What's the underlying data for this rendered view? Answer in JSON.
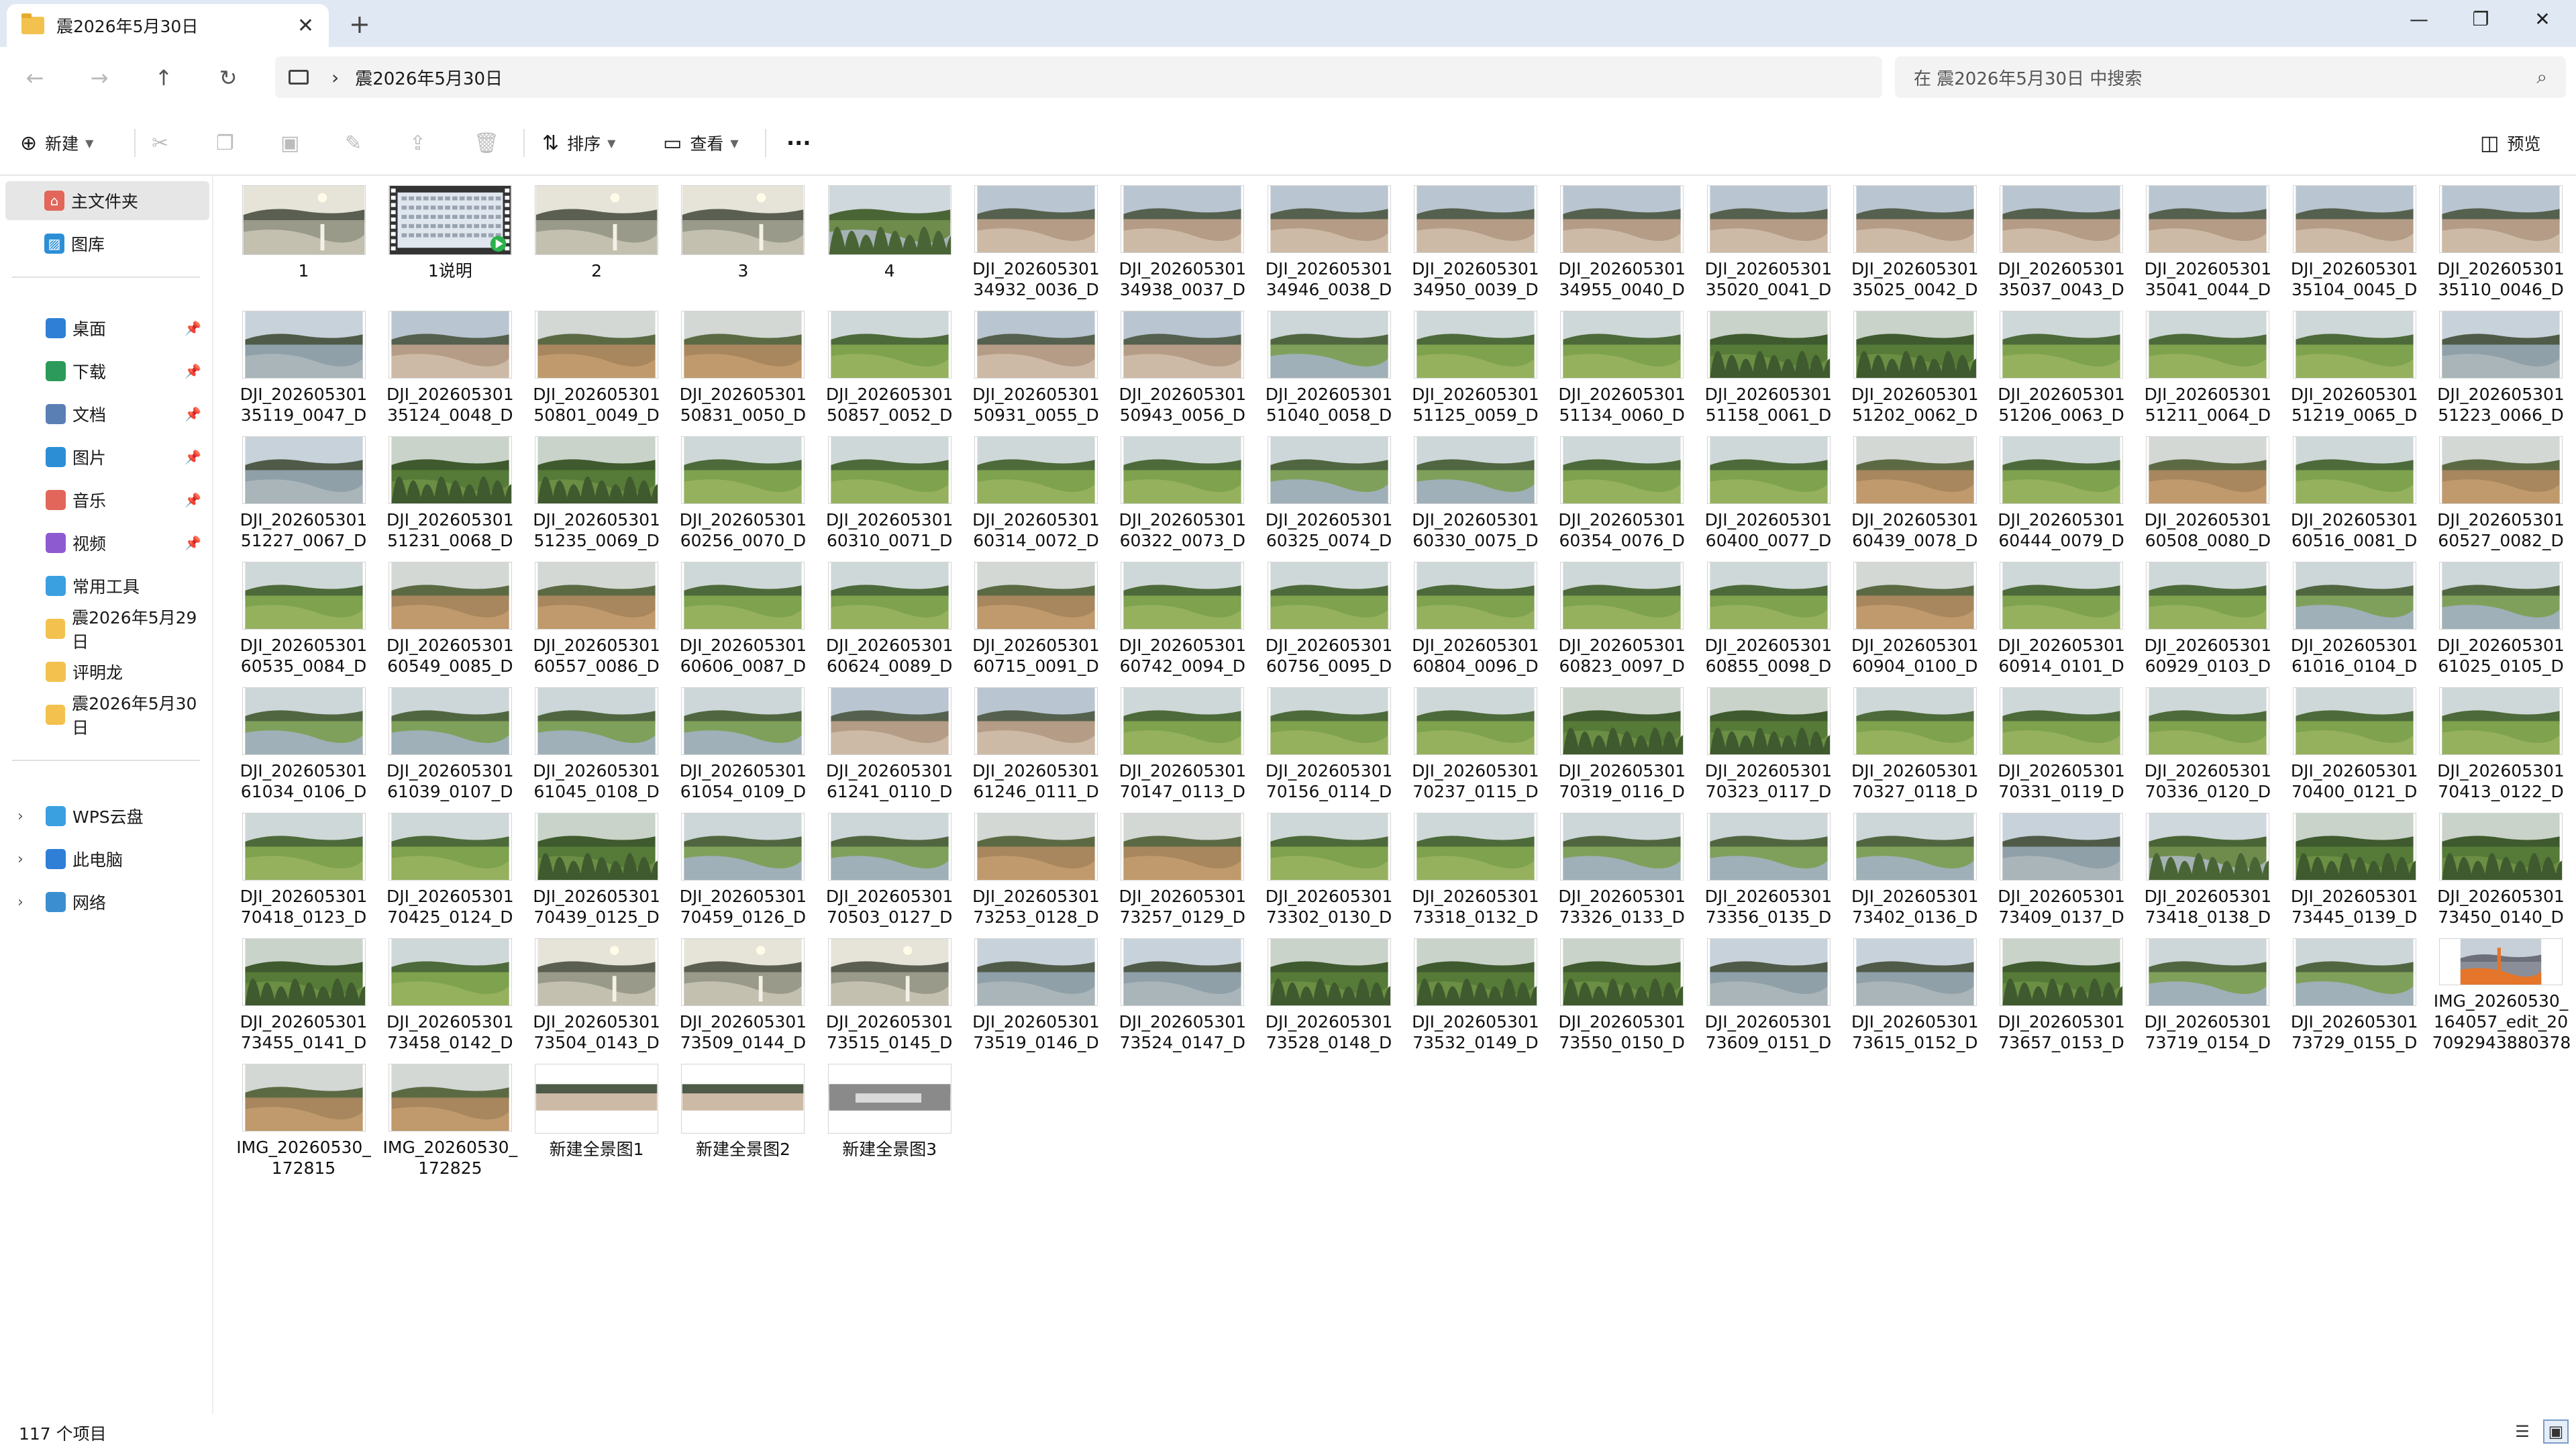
{
  "window": {
    "tab_title": "震2026年5月30日",
    "close_tab": "✕",
    "new_tab": "+",
    "minimize": "—",
    "maximize": "❐",
    "close": "✕"
  },
  "address": {
    "crumb": "震2026年5月30日",
    "search_placeholder": "在 震2026年5月30日 中搜索"
  },
  "toolbar": {
    "new_label": "新建",
    "sort_label": "排序",
    "view_label": "查看",
    "more_label": "···",
    "preview_label": "预览"
  },
  "sidebar": {
    "home": "主文件夹",
    "gallery": "图库",
    "quick": [
      {
        "label": "桌面",
        "icon": "desktop-icon",
        "color": "#2f7fd6"
      },
      {
        "label": "下载",
        "icon": "download-icon",
        "color": "#2c9a5a"
      },
      {
        "label": "文档",
        "icon": "documents-icon",
        "color": "#5a7fb5"
      },
      {
        "label": "图片",
        "icon": "pictures-icon",
        "color": "#2c8fd6"
      },
      {
        "label": "音乐",
        "icon": "music-icon",
        "color": "#e2665a"
      },
      {
        "label": "视频",
        "icon": "videos-icon",
        "color": "#8e5ad0"
      }
    ],
    "folders": [
      "常用工具",
      "震2026年5月29日",
      "评明龙",
      "震2026年5月30日"
    ],
    "locations": [
      "WPS云盘",
      "此电脑",
      "网络"
    ]
  },
  "status": {
    "item_count": "117 个项目"
  },
  "files": [
    {
      "l1": "1",
      "l2": "",
      "t": "lake-sunset"
    },
    {
      "l1": "1说明",
      "l2": "",
      "t": "video"
    },
    {
      "l1": "2",
      "l2": "",
      "t": "lake-sunset"
    },
    {
      "l1": "3",
      "l2": "",
      "t": "lake-sunset"
    },
    {
      "l1": "4",
      "l2": "",
      "t": "shore-trees"
    },
    {
      "l1": "DJI_202605301",
      "l2": "34932_0036_D",
      "t": "mudflat"
    },
    {
      "l1": "DJI_202605301",
      "l2": "34938_0037_D",
      "t": "mudflat"
    },
    {
      "l1": "DJI_202605301",
      "l2": "34946_0038_D",
      "t": "mudflat"
    },
    {
      "l1": "DJI_202605301",
      "l2": "34950_0039_D",
      "t": "mudflat"
    },
    {
      "l1": "DJI_202605301",
      "l2": "34955_0040_D",
      "t": "mudflat"
    },
    {
      "l1": "DJI_202605301",
      "l2": "35020_0041_D",
      "t": "mudflat"
    },
    {
      "l1": "DJI_202605301",
      "l2": "35025_0042_D",
      "t": "mudflat"
    },
    {
      "l1": "DJI_202605301",
      "l2": "35037_0043_D",
      "t": "mudflat"
    },
    {
      "l1": "DJI_202605301",
      "l2": "35041_0044_D",
      "t": "mudflat"
    },
    {
      "l1": "DJI_202605301",
      "l2": "35104_0045_D",
      "t": "mudflat"
    },
    {
      "l1": "DJI_202605301",
      "l2": "35110_0046_D",
      "t": "mudflat"
    },
    {
      "l1": "DJI_202605301",
      "l2": "35119_0047_D",
      "t": "lake"
    },
    {
      "l1": "DJI_202605301",
      "l2": "35124_0048_D",
      "t": "mudflat"
    },
    {
      "l1": "DJI_202605301",
      "l2": "50801_0049_D",
      "t": "field-brown"
    },
    {
      "l1": "DJI_202605301",
      "l2": "50831_0050_D",
      "t": "field-brown"
    },
    {
      "l1": "DJI_202605301",
      "l2": "50857_0052_D",
      "t": "grass-field"
    },
    {
      "l1": "DJI_202605301",
      "l2": "50931_0055_D",
      "t": "mudflat"
    },
    {
      "l1": "DJI_202605301",
      "l2": "50943_0056_D",
      "t": "mudflat"
    },
    {
      "l1": "DJI_202605301",
      "l2": "51040_0058_D",
      "t": "river"
    },
    {
      "l1": "DJI_202605301",
      "l2": "51125_0059_D",
      "t": "grass-field"
    },
    {
      "l1": "DJI_202605301",
      "l2": "51134_0060_D",
      "t": "grass-field"
    },
    {
      "l1": "DJI_202605301",
      "l2": "51158_0061_D",
      "t": "trees"
    },
    {
      "l1": "DJI_202605301",
      "l2": "51202_0062_D",
      "t": "trees"
    },
    {
      "l1": "DJI_202605301",
      "l2": "51206_0063_D",
      "t": "grass-field"
    },
    {
      "l1": "DJI_202605301",
      "l2": "51211_0064_D",
      "t": "grass-field"
    },
    {
      "l1": "DJI_202605301",
      "l2": "51219_0065_D",
      "t": "grass-field"
    },
    {
      "l1": "DJI_202605301",
      "l2": "51223_0066_D",
      "t": "lake"
    },
    {
      "l1": "DJI_202605301",
      "l2": "51227_0067_D",
      "t": "lake"
    },
    {
      "l1": "DJI_202605301",
      "l2": "51231_0068_D",
      "t": "trees"
    },
    {
      "l1": "DJI_202605301",
      "l2": "51235_0069_D",
      "t": "trees"
    },
    {
      "l1": "DJI_202605301",
      "l2": "60256_0070_D",
      "t": "grass-field"
    },
    {
      "l1": "DJI_202605301",
      "l2": "60310_0071_D",
      "t": "grass-field"
    },
    {
      "l1": "DJI_202605301",
      "l2": "60314_0072_D",
      "t": "grass-field"
    },
    {
      "l1": "DJI_202605301",
      "l2": "60322_0073_D",
      "t": "grass-field"
    },
    {
      "l1": "DJI_202605301",
      "l2": "60325_0074_D",
      "t": "river"
    },
    {
      "l1": "DJI_202605301",
      "l2": "60330_0075_D",
      "t": "river"
    },
    {
      "l1": "DJI_202605301",
      "l2": "60354_0076_D",
      "t": "grass-field"
    },
    {
      "l1": "DJI_202605301",
      "l2": "60400_0077_D",
      "t": "grass-field"
    },
    {
      "l1": "DJI_202605301",
      "l2": "60439_0078_D",
      "t": "field-brown"
    },
    {
      "l1": "DJI_202605301",
      "l2": "60444_0079_D",
      "t": "grass-field"
    },
    {
      "l1": "DJI_202605301",
      "l2": "60508_0080_D",
      "t": "field-brown"
    },
    {
      "l1": "DJI_202605301",
      "l2": "60516_0081_D",
      "t": "grass-field"
    },
    {
      "l1": "DJI_202605301",
      "l2": "60527_0082_D",
      "t": "field-brown"
    },
    {
      "l1": "DJI_202605301",
      "l2": "60535_0084_D",
      "t": "grass-field"
    },
    {
      "l1": "DJI_202605301",
      "l2": "60549_0085_D",
      "t": "field-brown"
    },
    {
      "l1": "DJI_202605301",
      "l2": "60557_0086_D",
      "t": "field-brown"
    },
    {
      "l1": "DJI_202605301",
      "l2": "60606_0087_D",
      "t": "grass-field"
    },
    {
      "l1": "DJI_202605301",
      "l2": "60624_0089_D",
      "t": "grass-field"
    },
    {
      "l1": "DJI_202605301",
      "l2": "60715_0091_D",
      "t": "field-brown"
    },
    {
      "l1": "DJI_202605301",
      "l2": "60742_0094_D",
      "t": "grass-field"
    },
    {
      "l1": "DJI_202605301",
      "l2": "60756_0095_D",
      "t": "grass-field"
    },
    {
      "l1": "DJI_202605301",
      "l2": "60804_0096_D",
      "t": "grass-field"
    },
    {
      "l1": "DJI_202605301",
      "l2": "60823_0097_D",
      "t": "grass-field"
    },
    {
      "l1": "DJI_202605301",
      "l2": "60855_0098_D",
      "t": "grass-field"
    },
    {
      "l1": "DJI_202605301",
      "l2": "60904_0100_D",
      "t": "field-brown"
    },
    {
      "l1": "DJI_202605301",
      "l2": "60914_0101_D",
      "t": "grass-field"
    },
    {
      "l1": "DJI_202605301",
      "l2": "60929_0103_D",
      "t": "grass-field"
    },
    {
      "l1": "DJI_202605301",
      "l2": "61016_0104_D",
      "t": "river"
    },
    {
      "l1": "DJI_202605301",
      "l2": "61025_0105_D",
      "t": "river"
    },
    {
      "l1": "DJI_202605301",
      "l2": "61034_0106_D",
      "t": "river"
    },
    {
      "l1": "DJI_202605301",
      "l2": "61039_0107_D",
      "t": "river"
    },
    {
      "l1": "DJI_202605301",
      "l2": "61045_0108_D",
      "t": "river"
    },
    {
      "l1": "DJI_202605301",
      "l2": "61054_0109_D",
      "t": "river"
    },
    {
      "l1": "DJI_202605301",
      "l2": "61241_0110_D",
      "t": "mudflat"
    },
    {
      "l1": "DJI_202605301",
      "l2": "61246_0111_D",
      "t": "mudflat"
    },
    {
      "l1": "DJI_202605301",
      "l2": "70147_0113_D",
      "t": "grass-field"
    },
    {
      "l1": "DJI_202605301",
      "l2": "70156_0114_D",
      "t": "grass-field"
    },
    {
      "l1": "DJI_202605301",
      "l2": "70237_0115_D",
      "t": "grass-field"
    },
    {
      "l1": "DJI_202605301",
      "l2": "70319_0116_D",
      "t": "trees"
    },
    {
      "l1": "DJI_202605301",
      "l2": "70323_0117_D",
      "t": "trees"
    },
    {
      "l1": "DJI_202605301",
      "l2": "70327_0118_D",
      "t": "grass-field"
    },
    {
      "l1": "DJI_202605301",
      "l2": "70331_0119_D",
      "t": "grass-field"
    },
    {
      "l1": "DJI_202605301",
      "l2": "70336_0120_D",
      "t": "grass-field"
    },
    {
      "l1": "DJI_202605301",
      "l2": "70400_0121_D",
      "t": "grass-field"
    },
    {
      "l1": "DJI_202605301",
      "l2": "70413_0122_D",
      "t": "grass-field"
    },
    {
      "l1": "DJI_202605301",
      "l2": "70418_0123_D",
      "t": "grass-field"
    },
    {
      "l1": "DJI_202605301",
      "l2": "70425_0124_D",
      "t": "grass-field"
    },
    {
      "l1": "DJI_202605301",
      "l2": "70439_0125_D",
      "t": "trees"
    },
    {
      "l1": "DJI_202605301",
      "l2": "70459_0126_D",
      "t": "river"
    },
    {
      "l1": "DJI_202605301",
      "l2": "70503_0127_D",
      "t": "river"
    },
    {
      "l1": "DJI_202605301",
      "l2": "73253_0128_D",
      "t": "field-brown"
    },
    {
      "l1": "DJI_202605301",
      "l2": "73257_0129_D",
      "t": "field-brown"
    },
    {
      "l1": "DJI_202605301",
      "l2": "73302_0130_D",
      "t": "grass-field"
    },
    {
      "l1": "DJI_202605301",
      "l2": "73318_0132_D",
      "t": "grass-field"
    },
    {
      "l1": "DJI_202605301",
      "l2": "73326_0133_D",
      "t": "river"
    },
    {
      "l1": "DJI_202605301",
      "l2": "73356_0135_D",
      "t": "river"
    },
    {
      "l1": "DJI_202605301",
      "l2": "73402_0136_D",
      "t": "river"
    },
    {
      "l1": "DJI_202605301",
      "l2": "73409_0137_D",
      "t": "lake"
    },
    {
      "l1": "DJI_202605301",
      "l2": "73418_0138_D",
      "t": "shore-trees"
    },
    {
      "l1": "DJI_202605301",
      "l2": "73445_0139_D",
      "t": "trees"
    },
    {
      "l1": "DJI_202605301",
      "l2": "73450_0140_D",
      "t": "trees"
    },
    {
      "l1": "DJI_202605301",
      "l2": "73455_0141_D",
      "t": "trees"
    },
    {
      "l1": "DJI_202605301",
      "l2": "73458_0142_D",
      "t": "grass-field"
    },
    {
      "l1": "DJI_202605301",
      "l2": "73504_0143_D",
      "t": "lake-sunset"
    },
    {
      "l1": "DJI_202605301",
      "l2": "73509_0144_D",
      "t": "lake-sunset"
    },
    {
      "l1": "DJI_202605301",
      "l2": "73515_0145_D",
      "t": "lake-sunset"
    },
    {
      "l1": "DJI_202605301",
      "l2": "73519_0146_D",
      "t": "lake"
    },
    {
      "l1": "DJI_202605301",
      "l2": "73524_0147_D",
      "t": "lake"
    },
    {
      "l1": "DJI_202605301",
      "l2": "73528_0148_D",
      "t": "trees"
    },
    {
      "l1": "DJI_202605301",
      "l2": "73532_0149_D",
      "t": "trees"
    },
    {
      "l1": "DJI_202605301",
      "l2": "73550_0150_D",
      "t": "trees"
    },
    {
      "l1": "DJI_202605301",
      "l2": "73609_0151_D",
      "t": "lake"
    },
    {
      "l1": "DJI_202605301",
      "l2": "73615_0152_D",
      "t": "lake"
    },
    {
      "l1": "DJI_202605301",
      "l2": "73657_0153_D",
      "t": "trees"
    },
    {
      "l1": "DJI_202605301",
      "l2": "73719_0154_D",
      "t": "river"
    },
    {
      "l1": "DJI_202605301",
      "l2": "73729_0155_D",
      "t": "river"
    },
    {
      "l1": "IMG_20260530_",
      "l2": "164057_edit_20",
      "l3": "7092943880378",
      "t": "tower"
    },
    {
      "l1": "IMG_20260530_",
      "l2": "172815",
      "t": "field-brown"
    },
    {
      "l1": "IMG_20260530_",
      "l2": "172825",
      "t": "field-brown"
    },
    {
      "l1": "新建全景图1",
      "l2": "",
      "t": "pano"
    },
    {
      "l1": "新建全景图2",
      "l2": "",
      "t": "pano"
    },
    {
      "l1": "新建全景图3",
      "l2": "",
      "t": "pano-dark"
    }
  ],
  "thumb_palettes": {
    "mudflat": [
      "#b9c6d1",
      "#55604e",
      "#b49c86",
      "#cdbaa6"
    ],
    "lake": [
      "#c8d2da",
      "#4f5a48",
      "#8fa0a8",
      "#a9b5b9"
    ],
    "lake-sunset": [
      "#e6e4d8",
      "#5a5f52",
      "#9a9a8a",
      "#c3c0b0"
    ],
    "river": [
      "#cdd6d8",
      "#506640",
      "#7fa05a",
      "#9fb0b8"
    ],
    "grass-field": [
      "#cfd8d8",
      "#4d6a3a",
      "#7ea24e",
      "#95b15e"
    ],
    "field-brown": [
      "#d3d8d4",
      "#5c6a44",
      "#a8875e",
      "#c09a6c"
    ],
    "trees": [
      "#c9d3c9",
      "#3f5a2e",
      "#567a37",
      "#6a8e43"
    ],
    "shore-trees": [
      "#cfd8dc",
      "#4a6535",
      "#6f8c4c",
      "#a5b2b5"
    ],
    "pano": [
      "#ffffff",
      "#4f5a48",
      "#a58f7a",
      "#cdbaa6"
    ],
    "pano-dark": [
      "#ffffff",
      "#3a3a3a",
      "#8a8a8a",
      "#c8c8c8"
    ],
    "tower": [
      "#c7cfd8",
      "#6d6f7a",
      "#8a8e98",
      "#e4752a"
    ],
    "video": [
      "#ffffff",
      "#333333",
      "#dfe6ee",
      "#e9eef4"
    ]
  }
}
